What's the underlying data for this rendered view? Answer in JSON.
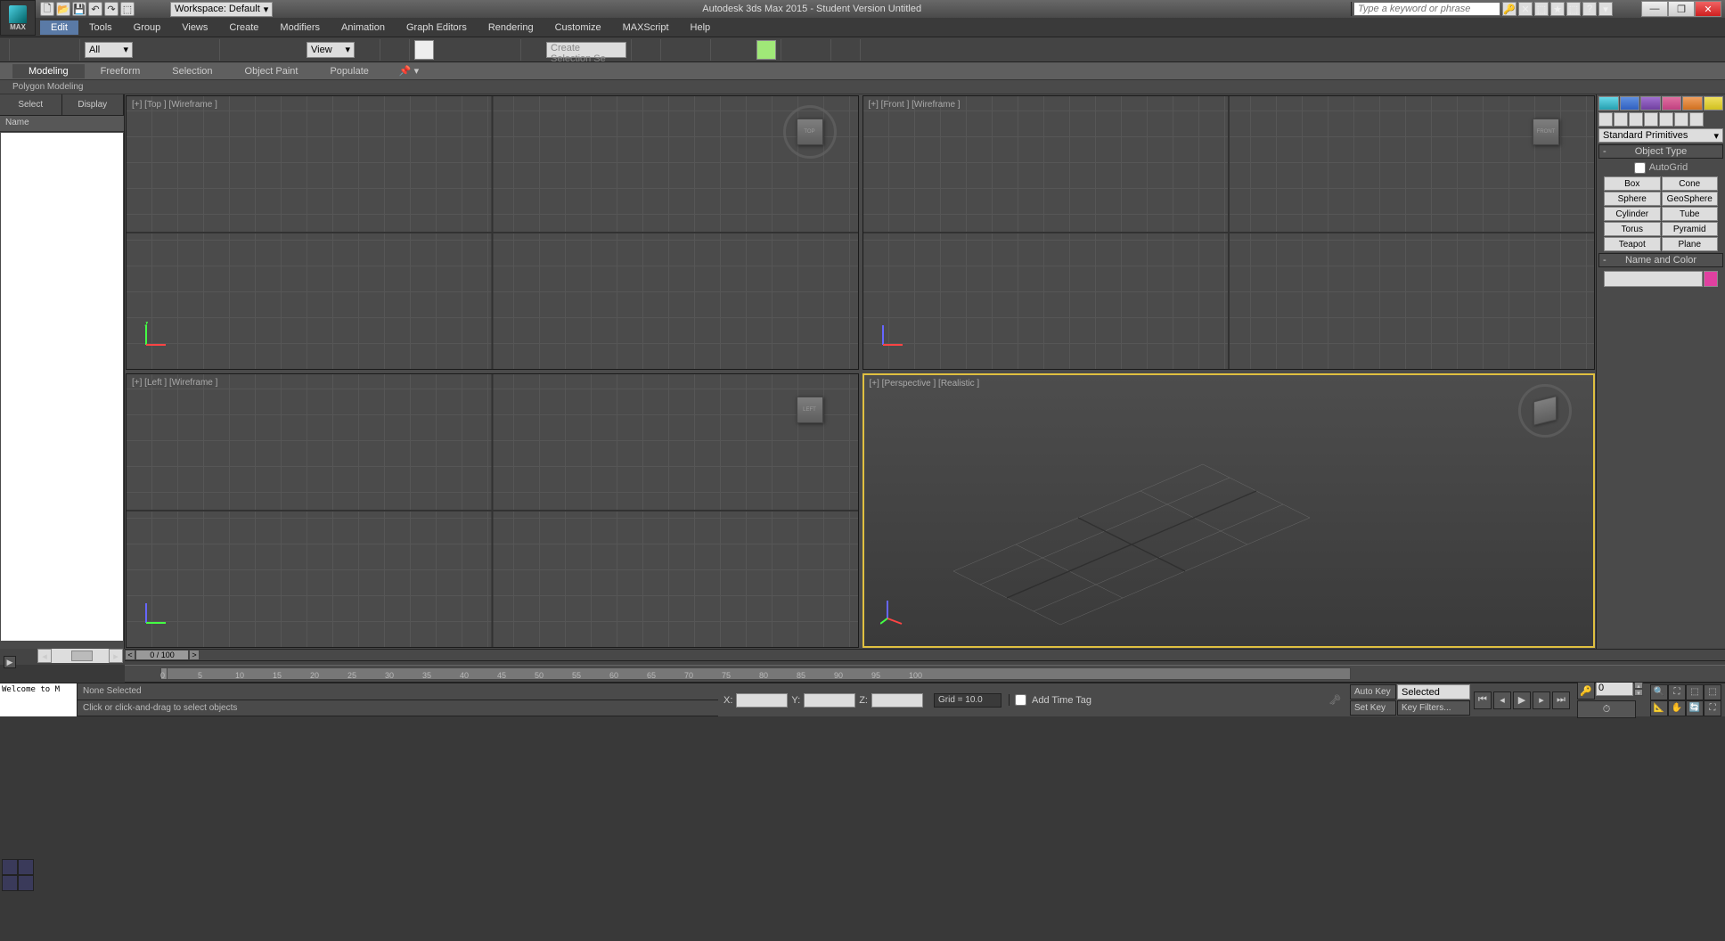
{
  "title": "Autodesk 3ds Max 2015 - Student Version   Untitled",
  "workspace_label": "Workspace: Default",
  "search_placeholder": "Type a keyword or phrase",
  "menu": [
    "Edit",
    "Tools",
    "Group",
    "Views",
    "Create",
    "Modifiers",
    "Animation",
    "Graph Editors",
    "Rendering",
    "Customize",
    "MAXScript",
    "Help"
  ],
  "toolbar": {
    "sel_filter": "All",
    "ref_sys": "View",
    "named_sel": "Create Selection Se"
  },
  "ribbon": {
    "tabs": [
      "Modeling",
      "Freeform",
      "Selection",
      "Object Paint",
      "Populate"
    ],
    "panel": "Polygon Modeling"
  },
  "left_panel": {
    "tabs": [
      "Select",
      "Display"
    ],
    "col": "Name"
  },
  "viewports": {
    "top": "[+] [Top ] [Wireframe ]",
    "front": "[+] [Front ] [Wireframe ]",
    "left": "[+] [Left ] [Wireframe ]",
    "persp": "[+] [Perspective ] [Realistic ]"
  },
  "cmd": {
    "category": "Standard Primitives",
    "rollout_type": "Object Type",
    "autogrid": "AutoGrid",
    "buttons": [
      "Box",
      "Cone",
      "Sphere",
      "GeoSphere",
      "Cylinder",
      "Tube",
      "Torus",
      "Pyramid",
      "Teapot",
      "Plane"
    ],
    "rollout_name": "Name and Color"
  },
  "timeline": {
    "pos": "0 / 100"
  },
  "ruler_ticks": [
    0,
    5,
    10,
    15,
    20,
    25,
    30,
    35,
    40,
    45,
    50,
    55,
    60,
    65,
    70,
    75,
    80,
    85,
    90,
    95,
    100
  ],
  "status": {
    "sel": "None Selected",
    "prompt": "Click or click-and-drag to select objects",
    "x": "X:",
    "y": "Y:",
    "z": "Z:",
    "grid": "Grid = 10.0",
    "autokey": "Auto Key",
    "setkey": "Set Key",
    "key_mode": "Selected",
    "keyfilters": "Key Filters...",
    "time_tag": "Add Time Tag",
    "frame": "0",
    "listener": "Welcome to M"
  }
}
